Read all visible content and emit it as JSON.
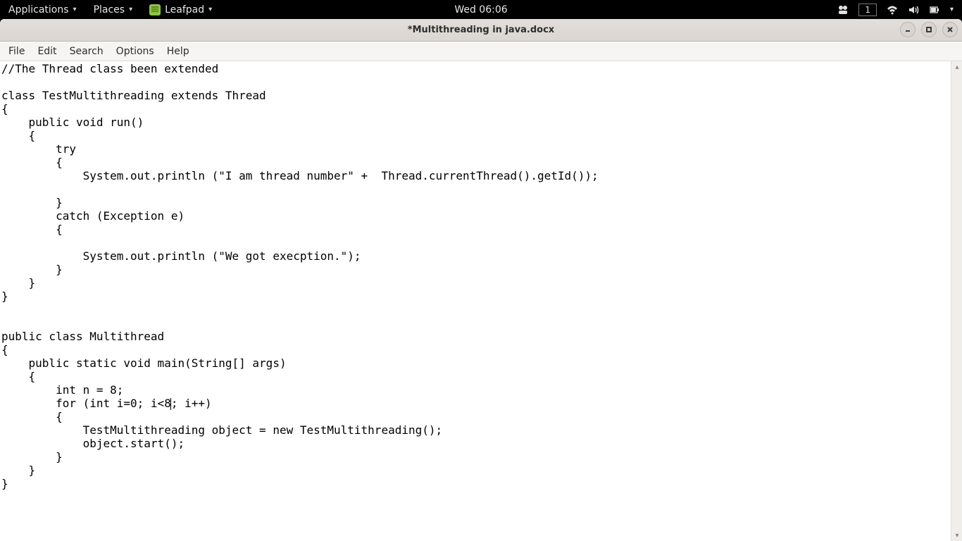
{
  "panel": {
    "applications": "Applications",
    "places": "Places",
    "app_name": "Leafpad",
    "clock": "Wed 06:06",
    "workspace": "1"
  },
  "window": {
    "title": "*Multithreading in java.docx"
  },
  "menubar": {
    "file": "File",
    "edit": "Edit",
    "search": "Search",
    "options": "Options",
    "help": "Help"
  },
  "editor": {
    "before_cursor": "//The Thread class been extended\n\nclass TestMultithreading extends Thread\n{\n    public void run()\n    {\n        try\n        {\n            System.out.println (\"I am thread number\" +  Thread.currentThread().getId());\n\n        }\n        catch (Exception e)\n        {\n\n            System.out.println (\"We got execption.\");\n        }\n    }\n}\n\n\npublic class Multithread\n{\n    public static void main(String[] args)\n    {\n        int n = 8;\n        for (int i=0; i<8",
    "after_cursor": "; i++)\n        {\n            TestMultithreading object = new TestMultithreading();\n            object.start();\n        }\n    }\n}\n"
  }
}
